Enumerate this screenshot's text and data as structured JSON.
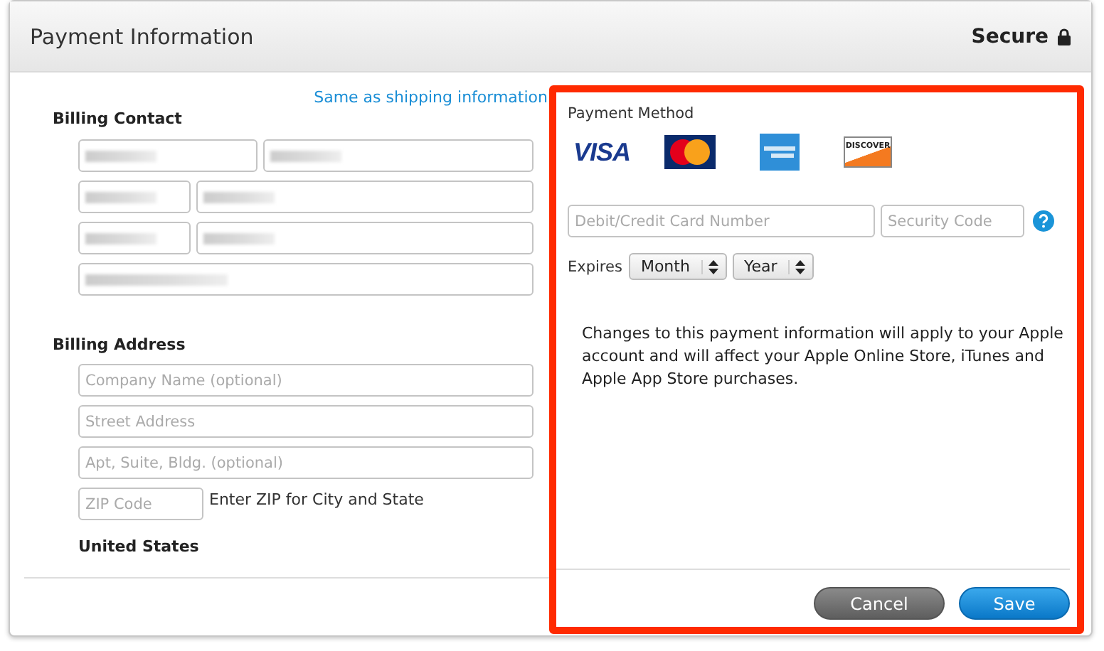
{
  "header": {
    "title": "Payment Information",
    "secure_label": "Secure"
  },
  "billing_contact": {
    "link": "Same as shipping information",
    "heading": "Billing Contact",
    "rows": [
      {
        "fields": [
          {
            "kind": "redacted"
          },
          {
            "kind": "redacted"
          }
        ]
      },
      {
        "fields": [
          {
            "kind": "redacted"
          },
          {
            "kind": "redacted"
          }
        ]
      },
      {
        "fields": [
          {
            "kind": "redacted"
          },
          {
            "kind": "redacted"
          }
        ]
      },
      {
        "fields": [
          {
            "kind": "redacted"
          }
        ]
      }
    ]
  },
  "billing_address": {
    "heading": "Billing Address",
    "fields": [
      {
        "placeholder": "Company Name (optional)"
      },
      {
        "placeholder": "Street Address"
      },
      {
        "placeholder": "Apt, Suite, Bldg. (optional)"
      }
    ],
    "zip": {
      "placeholder": "ZIP Code",
      "hint": "Enter ZIP for City and State"
    },
    "country": "United States"
  },
  "payment": {
    "heading": "Payment Method",
    "highlighted": true,
    "card_logos": [
      {
        "kind": "visa",
        "label": "VISA"
      },
      {
        "kind": "mastercard"
      },
      {
        "kind": "amex"
      },
      {
        "kind": "discover",
        "label": "DISCOVER"
      }
    ],
    "card_number": {
      "placeholder": "Debit/Credit Card Number"
    },
    "security_code": {
      "placeholder": "Security Code"
    },
    "expires_label": "Expires",
    "selects": [
      "Month",
      "Year"
    ],
    "notice": "Changes to this payment information will apply to your Apple account and will affect your Apple Online Store, iTunes and Apple App Store purchases."
  },
  "buttons": [
    {
      "label": "Cancel",
      "kind": "secondary"
    },
    {
      "label": "Save",
      "kind": "primary"
    }
  ]
}
